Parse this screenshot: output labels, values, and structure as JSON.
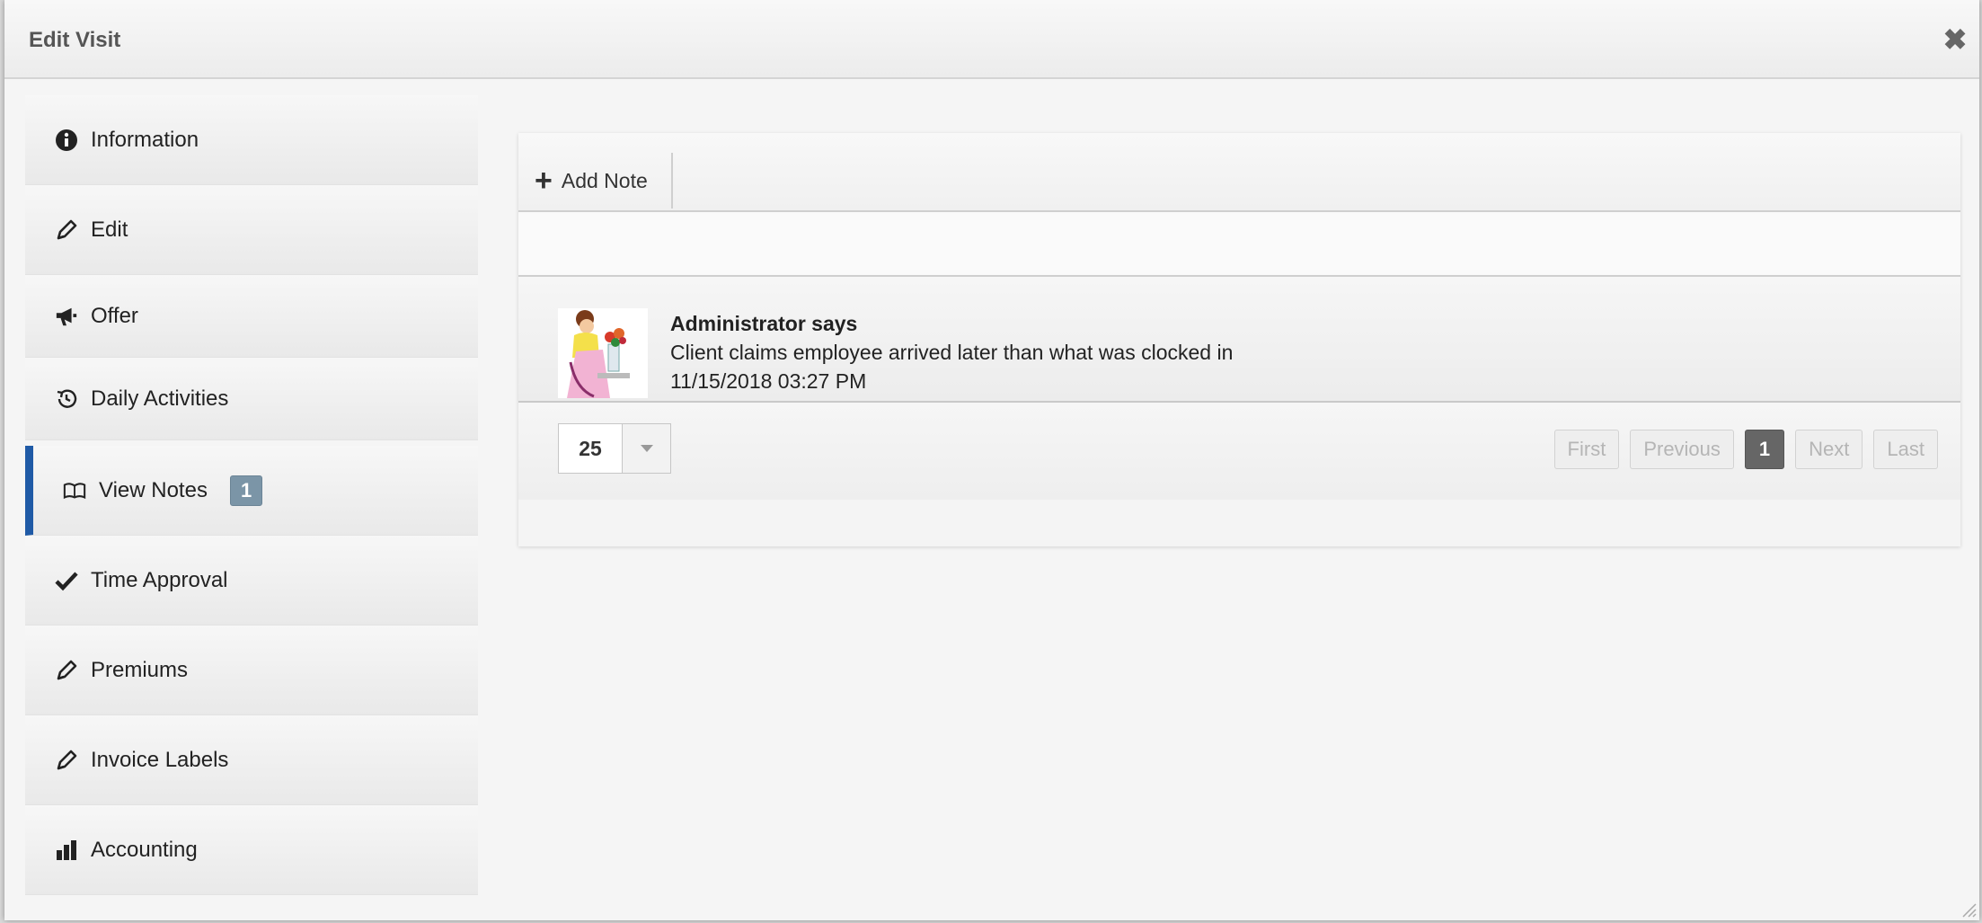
{
  "dialog": {
    "title": "Edit Visit",
    "close_icon": "close-icon"
  },
  "sidebar": {
    "items": [
      {
        "label": "Information",
        "icon": "info-icon"
      },
      {
        "label": "Edit",
        "icon": "pencil-icon"
      },
      {
        "label": "Offer",
        "icon": "bullhorn-icon"
      },
      {
        "label": "Daily Activities",
        "icon": "history-icon"
      },
      {
        "label": "View Notes",
        "icon": "book-icon",
        "badge": "1",
        "active": true
      },
      {
        "label": "Time Approval",
        "icon": "check-icon"
      },
      {
        "label": "Premiums",
        "icon": "pencil-icon"
      },
      {
        "label": "Invoice Labels",
        "icon": "pencil-icon"
      },
      {
        "label": "Accounting",
        "icon": "bar-chart-icon"
      }
    ]
  },
  "toolbar": {
    "add_note_label": "Add Note"
  },
  "notes": [
    {
      "author": "Administrator says",
      "text": "Client claims employee arrived later than what was clocked in",
      "timestamp": "11/15/2018 03:27 PM"
    }
  ],
  "pager": {
    "page_size": "25",
    "first_label": "First",
    "previous_label": "Previous",
    "current_page": "1",
    "next_label": "Next",
    "last_label": "Last"
  },
  "colors": {
    "accent": "#1f5aa6",
    "badge": "#7b95a7",
    "current_page": "#666666"
  }
}
